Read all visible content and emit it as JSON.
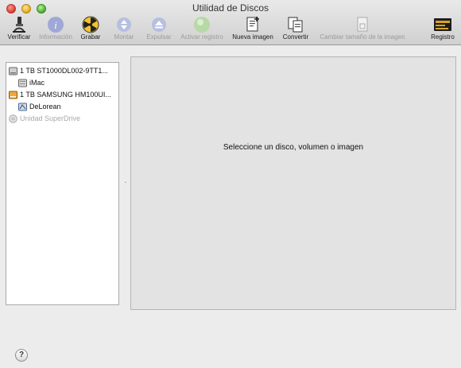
{
  "window": {
    "title": "Utilidad de Discos"
  },
  "toolbar": {
    "items": [
      {
        "label": "Verificar",
        "icon": "microscope-icon",
        "enabled": true
      },
      {
        "label": "Información",
        "icon": "info-icon",
        "enabled": false
      },
      {
        "label": "Grabar",
        "icon": "burn-icon",
        "enabled": true
      },
      {
        "label": "Montar",
        "icon": "mount-icon",
        "enabled": false
      },
      {
        "label": "Expulsar",
        "icon": "eject-icon",
        "enabled": false
      },
      {
        "label": "Activar registro",
        "icon": "enable-journaling-icon",
        "enabled": false
      },
      {
        "label": "Nueva imagen",
        "icon": "new-image-icon",
        "enabled": true
      },
      {
        "label": "Convertir",
        "icon": "convert-icon",
        "enabled": true
      },
      {
        "label": "Cambiar tamaño de la imagen",
        "icon": "resize-image-icon",
        "enabled": false
      },
      {
        "label": "Registro",
        "icon": "log-icon",
        "enabled": true
      }
    ]
  },
  "sidebar": {
    "items": [
      {
        "label": "1 TB ST1000DL002-9TT1...",
        "icon": "hard-disk-icon",
        "dim": false
      },
      {
        "label": "iMac",
        "icon": "volume-icon",
        "dim": false
      },
      {
        "label": "1 TB SAMSUNG HM100UI...",
        "icon": "external-disk-icon",
        "dim": false
      },
      {
        "label": "DeLorean",
        "icon": "volume-icon",
        "dim": false
      },
      {
        "label": "Unidad SuperDrive",
        "icon": "superdrive-icon",
        "dim": true
      }
    ]
  },
  "main": {
    "message": "Seleccione un disco, volumen o imagen"
  },
  "footer": {
    "help_label": "?"
  }
}
